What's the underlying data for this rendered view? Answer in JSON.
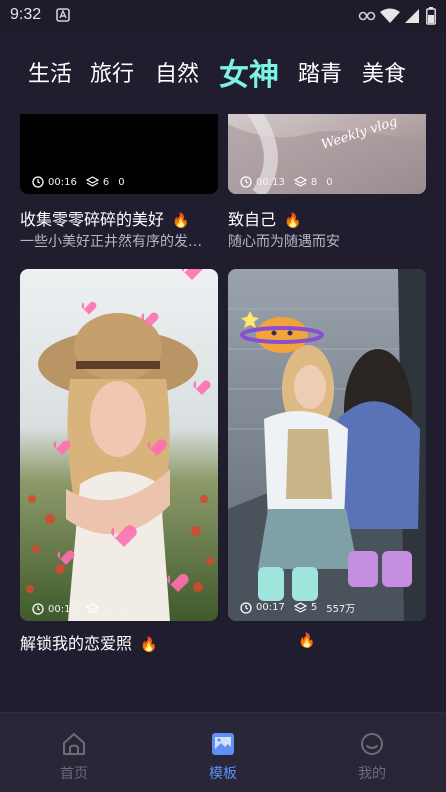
{
  "status_bar": {
    "time": "9:32"
  },
  "tabs": [
    "生活",
    "旅行",
    "自然",
    "女神",
    "踏青",
    "美食"
  ],
  "active_tab": "女神",
  "cards": [
    {
      "duration": "00:16",
      "layers": "6",
      "uses": "0",
      "title": "收集零零碎碎的美好",
      "desc": "一些小美好正井然有序的发…"
    },
    {
      "duration": "00:13",
      "layers": "8",
      "uses": "0",
      "title": "致自己",
      "desc": "随心而为随遇而安",
      "overlay_text": "Weekly vlog"
    },
    {
      "duration": "00:15",
      "layers": "2",
      "uses": "0",
      "title": "解锁我的恋爱照"
    },
    {
      "duration": "00:17",
      "layers": "5",
      "uses": "557万",
      "title": ""
    }
  ],
  "bottom_nav": [
    {
      "label": "首页",
      "icon": "home-icon"
    },
    {
      "label": "模板",
      "icon": "template-icon"
    },
    {
      "label": "我的",
      "icon": "profile-icon"
    }
  ],
  "colors": {
    "background": "#1f1d2e",
    "active_tab": "#7af2e4",
    "nav_active": "#5e8ff5",
    "nav_inactive": "#6c6b7a"
  }
}
